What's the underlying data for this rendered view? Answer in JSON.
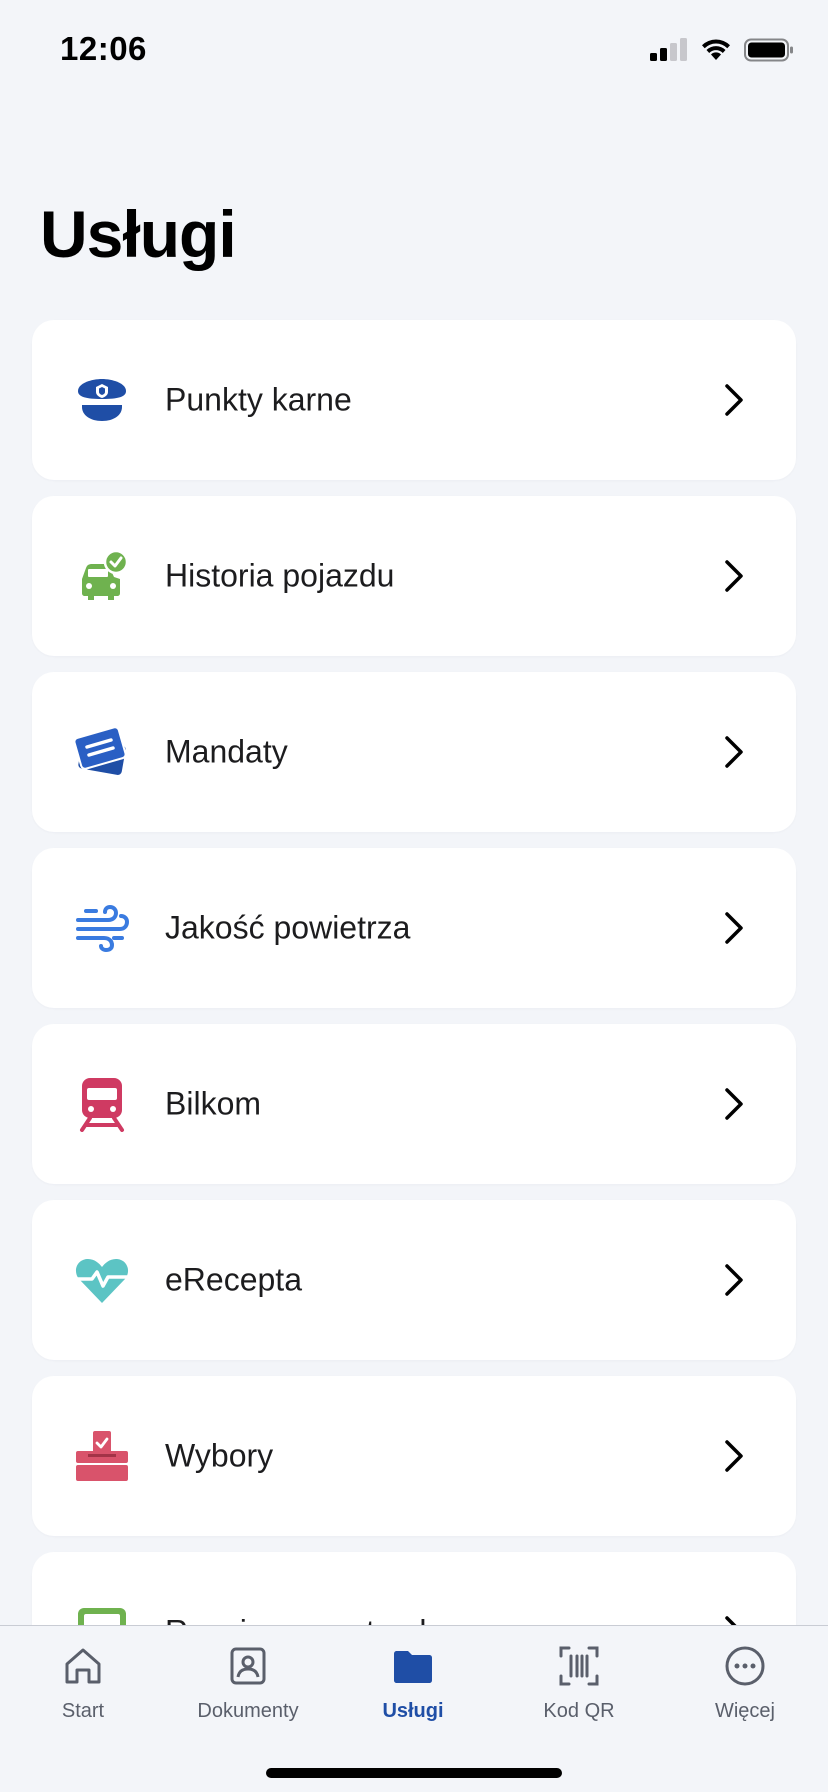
{
  "status": {
    "time": "12:06"
  },
  "page": {
    "title": "Usługi"
  },
  "services": [
    {
      "label": "Punkty karne",
      "icon": "police-cap-icon",
      "color": "#1f4ea6"
    },
    {
      "label": "Historia pojazdu",
      "icon": "car-check-icon",
      "color": "#6fb24f"
    },
    {
      "label": "Mandaty",
      "icon": "tickets-icon",
      "color": "#1f4ea6"
    },
    {
      "label": "Jakość powietrza",
      "icon": "wind-icon",
      "color": "#3a7be0"
    },
    {
      "label": "Bilkom",
      "icon": "train-icon",
      "color": "#cf3a62"
    },
    {
      "label": "eRecepta",
      "icon": "heart-pulse-icon",
      "color": "#5cc4c4"
    },
    {
      "label": "Wybory",
      "icon": "ballot-box-icon",
      "color": "#d9536b"
    },
    {
      "label": "Rozpiszę z potrzeb",
      "icon": "green-service-icon",
      "color": "#6fb24f"
    }
  ],
  "tabbar": {
    "items": [
      {
        "label": "Start",
        "icon": "home-icon",
        "active": false
      },
      {
        "label": "Dokumenty",
        "icon": "id-card-icon",
        "active": false
      },
      {
        "label": "Usługi",
        "icon": "folder-icon",
        "active": true
      },
      {
        "label": "Kod QR",
        "icon": "qr-scan-icon",
        "active": false
      },
      {
        "label": "Więcej",
        "icon": "more-icon",
        "active": false
      }
    ],
    "active_color": "#1f4ea6"
  }
}
